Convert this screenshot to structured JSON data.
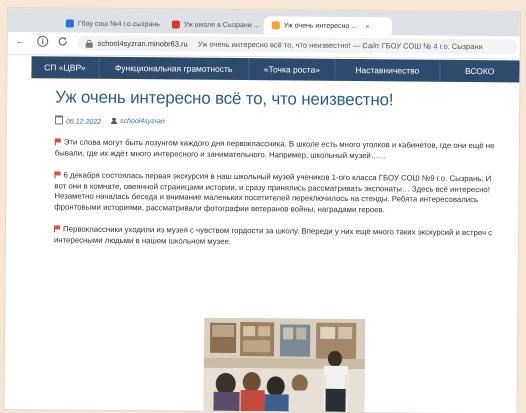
{
  "browser": {
    "tabs": [
      {
        "label": "Гбоу сош №4 г.о.сызрань",
        "active": false,
        "color": "#2e6fd6"
      },
      {
        "label": "Уж школе в Сызрани ...",
        "active": false,
        "color": "#d33b2c"
      },
      {
        "label": "Уж очень интересно ...",
        "active": true,
        "color": "#f4a52b"
      }
    ],
    "address": {
      "domain": "school4syzran.minobr63.ru",
      "page_title": "Уж очень интересно всё то, что неизвестно! — Сайт ГБОУ СОШ № 4 г.о. Сызрани"
    },
    "icons": {
      "back": "arrow-left-icon",
      "info": "info-circle-icon",
      "reload": "reload-icon",
      "lock": "lock-icon"
    }
  },
  "site_nav": {
    "items": [
      "СП «ЦВР»",
      "Функциональная грамотность",
      "«Точка роста»",
      "Наставничество",
      "ВСОКО"
    ]
  },
  "article": {
    "title": "Уж очень интересно всё то, что неизвестно!",
    "date": "06.12.2022",
    "author": "school4syzran",
    "paragraphs": [
      "Эти слова могут быть лозунгом каждого дня первоклассника. В школе есть много уголков и кабинетов, где они ещё не бывали, где их ждёт много интересного и занимательного. Например, школьный музей……",
      "6 декабря состоялась первая экскурсия в наш школьный музей учеников 1-ого класса ГБОУ СОШ №9 г.о. Сызрань. И вот они в комнате, овеянной страницами истории, и сразу принялись рассматривать экспонаты… Здесь всё интересно! Незаметно началась беседа и внимание маленьких посетителей переключилось на стенды. Ребята интересовались фронтовыми историями, рассматривали фотографии ветеранов войны, наградами героев.",
      "Первоклассники уходили из музея с чувством гордости за школу. Впереди у них ещё много таких экскурсий и встреч с интересными людьми в нашем школьном музее."
    ],
    "photo": "museum-visit-photo"
  },
  "colors": {
    "nav_bg": "#2e4b6e",
    "title": "#2a5d8c",
    "meta": "#3a6ea5",
    "background": "#f5e6d6"
  }
}
